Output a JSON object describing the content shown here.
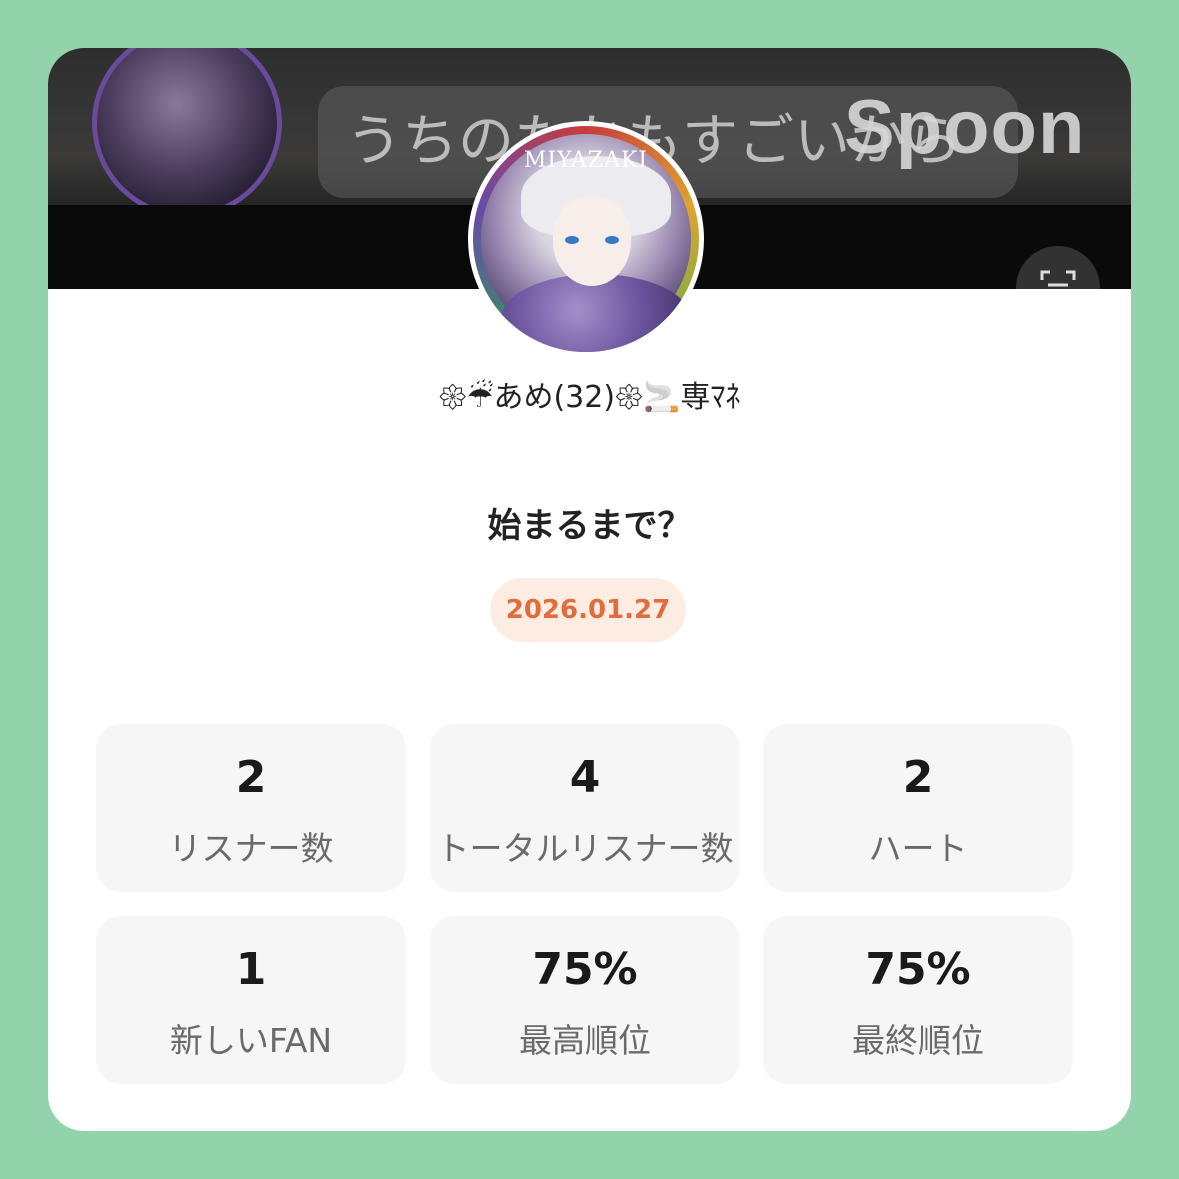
{
  "banner": {
    "chat_text": "うちのたかもすごいから",
    "brand": "Spoon",
    "button_icon": "scan-icon"
  },
  "avatar": {
    "caption": "MIYAZAKI"
  },
  "profile": {
    "username": "𑁍☔あめ(32)𑁍🚬専ﾏﾈ"
  },
  "event": {
    "title": "始まるまで？",
    "date": "2026.01.27"
  },
  "stats": [
    {
      "value": "2",
      "label": "リスナー数"
    },
    {
      "value": "4",
      "label": "トータルリスナー数"
    },
    {
      "value": "2",
      "label": "ハート"
    },
    {
      "value": "1",
      "label": "新しいFAN"
    },
    {
      "value": "75%",
      "label": "最高順位"
    },
    {
      "value": "75%",
      "label": "最終順位"
    }
  ],
  "colors": {
    "background": "#93d3ac",
    "card": "#ffffff",
    "accent": "#e06d3d",
    "badge_bg": "#fdece2",
    "stat_bg": "#f6f6f6"
  }
}
